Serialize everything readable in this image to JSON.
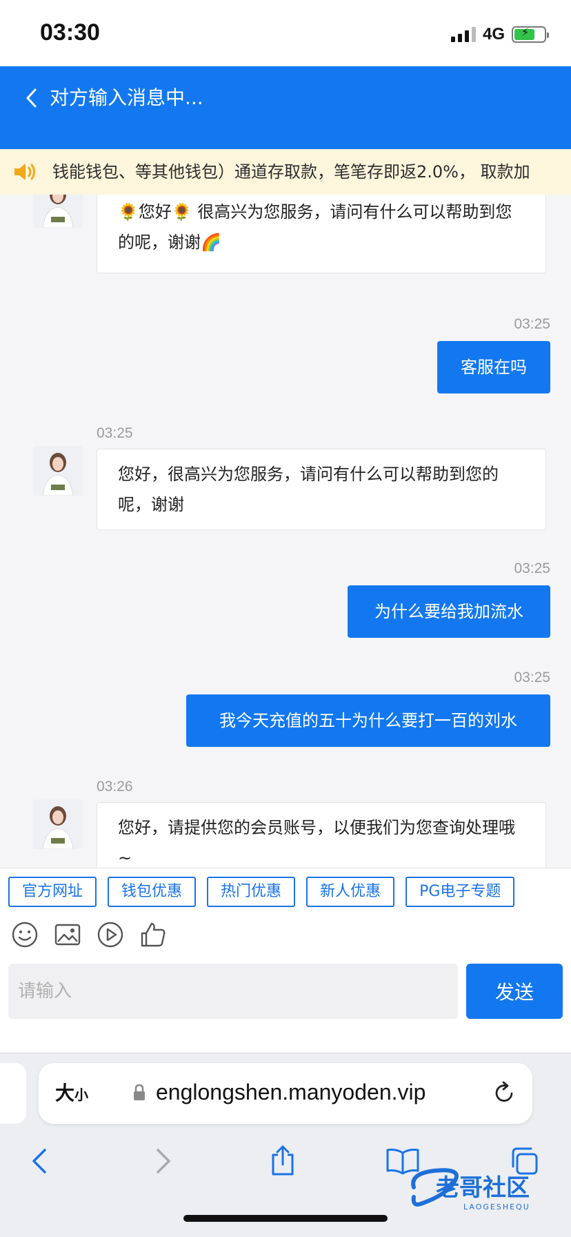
{
  "status_bar": {
    "time": "03:30",
    "network": "4G"
  },
  "header": {
    "title": "对方输入消息中..."
  },
  "notice": {
    "text": "钱能钱包、等其他钱包）通道存取款，笔笔存即返2.0%， 取款加"
  },
  "messages": [
    {
      "side": "left",
      "time": "",
      "text": "🌻您好🌻 很高兴为您服务，请问有什么可以帮助到您的呢，谢谢🌈"
    },
    {
      "side": "right",
      "time": "03:25",
      "text": "客服在吗"
    },
    {
      "side": "left",
      "time": "03:25",
      "text": "您好，很高兴为您服务，请问有什么可以帮助到您的呢，谢谢"
    },
    {
      "side": "right",
      "time": "03:25",
      "text": "为什么要给我加流水"
    },
    {
      "side": "right",
      "time": "03:25",
      "text": "我今天充值的五十为什么要打一百的刘水"
    },
    {
      "side": "left",
      "time": "03:26",
      "text": "您好，请提供您的会员账号，以便我们为您查询处理哦~"
    }
  ],
  "quick_links": [
    "官方网址",
    "钱包优惠",
    "热门优惠",
    "新人优惠",
    "PG电子专题"
  ],
  "tool_icons": [
    "emoji-icon",
    "image-icon",
    "video-icon",
    "thumbs-up-icon"
  ],
  "input": {
    "placeholder": "请输入",
    "send_label": "发送"
  },
  "browser": {
    "text_size_big": "大",
    "text_size_small": "小",
    "url": "englongshen.manyoden.vip",
    "nav_icons": [
      "back-icon",
      "forward-icon",
      "share-icon",
      "bookmarks-icon",
      "tabs-icon"
    ]
  },
  "watermark": {
    "text": "老哥社区",
    "subtext": "LAOGESHEQU"
  },
  "colors": {
    "accent": "#1378f0",
    "notice_bg": "#fdf5dc",
    "chat_bg": "#f5f5f7"
  }
}
